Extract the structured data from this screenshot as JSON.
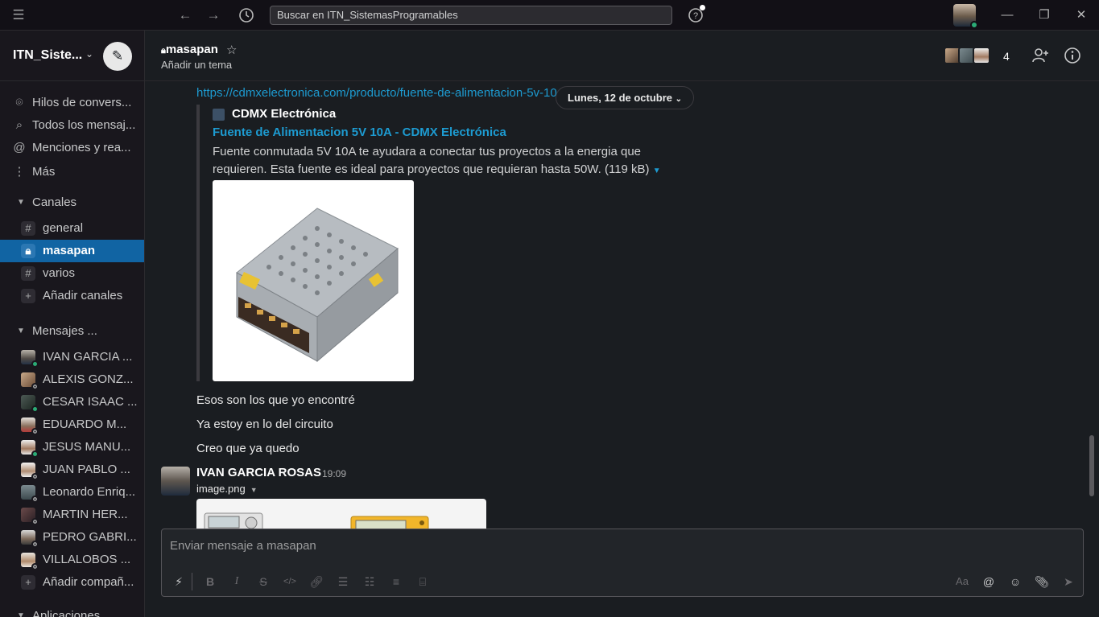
{
  "titlebar": {
    "search_placeholder": "Buscar en ITN_SistemasProgramables",
    "icons": [
      "hamburger-menu-icon",
      "back-arrow-icon",
      "forward-arrow-icon",
      "history-icon",
      "help-icon",
      "minimize-icon",
      "maximize-icon",
      "close-icon"
    ]
  },
  "workspace": {
    "name": "ITN_Siste..."
  },
  "sidebar": {
    "nav": [
      {
        "label": "Hilos de convers...",
        "icon": "threads-icon"
      },
      {
        "label": "Todos los mensaj...",
        "icon": "all-dms-icon"
      },
      {
        "label": "Menciones y rea...",
        "icon": "mentions-icon"
      },
      {
        "label": "Más",
        "icon": "more-icon"
      }
    ],
    "channels_section": "Canales",
    "channels": [
      {
        "label": "general",
        "icon": "#"
      },
      {
        "label": "masapan",
        "icon": "lock"
      },
      {
        "label": "varios",
        "icon": "#"
      }
    ],
    "add_channels": "Añadir canales",
    "dms_section": "Mensajes ...",
    "dms": [
      {
        "label": "IVAN GARCIA ...",
        "online": true
      },
      {
        "label": "ALEXIS GONZ...",
        "online": false
      },
      {
        "label": "CESAR ISAAC ...",
        "online": true
      },
      {
        "label": "EDUARDO M...",
        "online": false
      },
      {
        "label": "JESUS MANU...",
        "online": true
      },
      {
        "label": "JUAN PABLO ...",
        "online": false
      },
      {
        "label": "Leonardo Enriq...",
        "online": false
      },
      {
        "label": "MARTIN HER...",
        "online": false
      },
      {
        "label": "PEDRO GABRI...",
        "online": false
      },
      {
        "label": "VILLALOBOS ...",
        "online": false
      }
    ],
    "add_teammates": "Añadir compañ...",
    "apps_section": "Aplicaciones"
  },
  "channel": {
    "name": "masapan",
    "topic": "Añadir un tema",
    "member_count": "4"
  },
  "messages": {
    "link": "https://cdmxelectronica.com/producto/fuente-de-alimentacion-5v-10a/",
    "date_divider": "Lunes, 12 de octubre",
    "unfurl": {
      "site": "CDMX Electrónica",
      "title": "Fuente de Alimentacion 5V 10A - CDMX Electrónica",
      "description": "Fuente conmutada 5V 10A te ayudara a conectar tus proyectos a la energia que requieren. Esta fuente es ideal para proyectos que requieran hasta 50W. (119 kB)"
    },
    "lines": [
      "Esos son los que yo encontré",
      "Ya estoy en lo del circuito",
      "Creo que ya quedo"
    ],
    "next": {
      "author": "IVAN GARCIA ROSAS",
      "time": "19:09",
      "file": "image.png"
    }
  },
  "composer": {
    "placeholder": "Enviar mensaje a masapan",
    "text_format": "Aa"
  }
}
